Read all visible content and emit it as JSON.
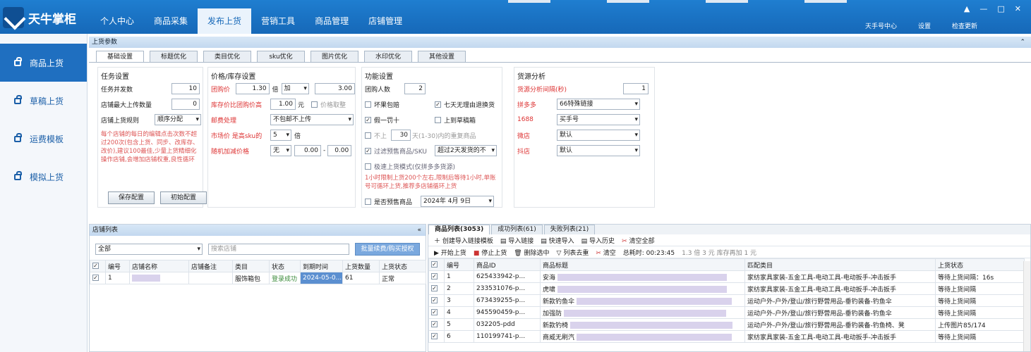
{
  "app": {
    "title": "天牛掌柜"
  },
  "nav": [
    "个人中心",
    "商品采集",
    "发布上货",
    "营销工具",
    "商品管理",
    "店铺管理"
  ],
  "top_right": [
    "天手号中心",
    "设置",
    "检查更新"
  ],
  "window_controls": [
    "▲",
    "—",
    "□",
    "✕"
  ],
  "sidebar": [
    "商品上货",
    "草稿上货",
    "运费模板",
    "模拟上货"
  ],
  "panel_title": "上货参数",
  "tabs": [
    "基础设置",
    "标题优化",
    "类目优化",
    "sku优化",
    "图片优化",
    "水印优化",
    "其他设置"
  ],
  "task": {
    "title": "任务设置",
    "concurrent_label": "任务并发数",
    "concurrent_value": "10",
    "max_label": "店铺最大上传数量",
    "max_value": "0",
    "rule_label": "店铺上货规则",
    "rule_value": "顺序分配",
    "note": "每个店铺的每日的编辑点击次数不超过200次(包含上货、同步、改库存、改价),建议100最佳,少量上货精细化操作店铺,会增加店铺权重,良性循环",
    "save": "保存配置",
    "init": "初始配置"
  },
  "price": {
    "title": "价格/库存设置",
    "group_label": "团购价",
    "group_val": "1.30",
    "times": "倍",
    "op": "加",
    "add_val": "3.00",
    "stock_label": "库存价比团购价高",
    "stock_val": "1.00",
    "unit": "元",
    "price_round": "价格取整",
    "postage_label": "邮费处理",
    "postage_val": "不包邮不上传",
    "market_label": "市场价 是高sku的",
    "market_val": "5",
    "market_unit": "倍",
    "random_label": "随机加减价格",
    "random_sel": "无",
    "rand_a": "0.00",
    "dash": "-",
    "rand_b": "0.00"
  },
  "func": {
    "title": "功能设置",
    "group_people_label": "团购人数",
    "group_people_val": "2",
    "c1": "坏果包赔",
    "c2": "七天无理由退换货",
    "c3": "假一罚十",
    "c4": "上到草稿箱",
    "not_up": "不上",
    "days": "30",
    "days_text": "天(1-30)内的重复商品",
    "presale_label": "过滤预售商品/SKU",
    "presale_val": "超过2天发货的不",
    "fast_mode": "极速上货模式(仅拼多多货源)",
    "fast_note": "1小时限制上货200个左右,限制后等待1小时,单账号可循环上货,推荐多店铺循环上货",
    "is_presale": "是否预售商品",
    "date": "2024年 4月 9日"
  },
  "source": {
    "title": "货源分析",
    "interval_label": "货源分析间隔(秒)",
    "interval_val": "1",
    "rows": [
      {
        "k": "拼多多",
        "v": "66特殊链接"
      },
      {
        "k": "1688",
        "v": "买手号"
      },
      {
        "k": "微店",
        "v": "默认"
      },
      {
        "k": "抖店",
        "v": "默认"
      }
    ]
  },
  "shop": {
    "title": "店铺列表",
    "filter": "全部",
    "search_placeholder": "搜索店铺",
    "batch_btn": "批量续费/购买授权",
    "cols": [
      "编号",
      "店铺名称",
      "店铺备注",
      "类目",
      "状态",
      "到期时间",
      "上货数量",
      "上货状态"
    ],
    "rows": [
      {
        "no": "1",
        "cat": "服饰箱包",
        "status": "登录成功",
        "expire": "2024-05-0...",
        "count": "61",
        "state": "正常"
      }
    ]
  },
  "goods": {
    "tabs": [
      "商品列表(3053)",
      "成功列表(61)",
      "失败列表(21)"
    ],
    "tool1": [
      "创建导入链接模板",
      "导入链接",
      "快速导入",
      "导入历史",
      "清空全部"
    ],
    "tool2": [
      "开始上货",
      "停止上货",
      "删除选中",
      "列表去重",
      "清空"
    ],
    "elapsed": "总耗时: 00:23:45",
    "speed": "1.3 倍 3 元 库存再加 1 元",
    "cols": [
      "编号",
      "商品ID",
      "商品标题",
      "匹配类目",
      "上货状态"
    ],
    "rows": [
      {
        "no": "1",
        "id": "625433942-p...",
        "title": "安海",
        "cat": "家纺家具家装-五金工具-电动工具-电动扳手-冲击扳手",
        "state": "等待上货间隔：16s"
      },
      {
        "no": "2",
        "id": "233531076-p...",
        "title": "虎啸",
        "cat": "家纺家具家装-五金工具-电动工具-电动扳手-冲击扳手",
        "state": "等待上货间隔"
      },
      {
        "no": "3",
        "id": "673439255-p...",
        "title": "新款钓鱼伞",
        "cat": "运动户外-户外/登山/旅行野营用品-垂钓装备-钓鱼伞",
        "state": "等待上货间隔"
      },
      {
        "no": "4",
        "id": "945590459-p...",
        "title": "加强防",
        "cat": "运动户外-户外/登山/旅行野营用品-垂钓装备-钓鱼伞",
        "state": "等待上货间隔"
      },
      {
        "no": "5",
        "id": "032205-pdd",
        "title": "新款钓椅",
        "cat": "运动户外-户外/登山/旅行野营用品-垂钓装备-钓鱼椅、凳",
        "state": "上传图片85/174"
      },
      {
        "no": "6",
        "id": "110199741-p...",
        "title": "商威无刷汽",
        "cat": "家纺家具家装-五金工具-电动工具-电动扳手-冲击扳手",
        "state": "等待上货间隔"
      }
    ]
  }
}
